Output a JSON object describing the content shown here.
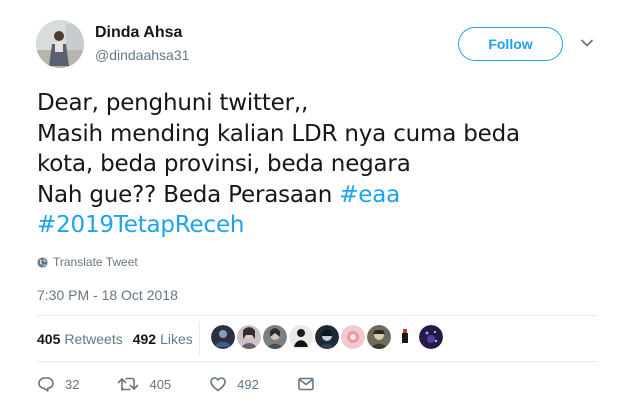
{
  "user": {
    "display_name": "Dinda Ahsa",
    "handle": "@dindaahsa31"
  },
  "follow_label": "Follow",
  "tweet": {
    "line1": "Dear, penghuni twitter,,",
    "line2": "Masih mending kalian LDR nya cuma beda",
    "line3": "kota, beda provinsi, beda negara",
    "line4_text": "Nah gue?? Beda Perasaan ",
    "hashtag1": "#eaa",
    "hashtag2": "#2019TetapReceh"
  },
  "translate_label": "Translate Tweet",
  "timestamp": "7:30 PM - 18 Oct 2018",
  "stats": {
    "retweets_count": "405",
    "retweets_label": "Retweets",
    "likes_count": "492",
    "likes_label": "Likes"
  },
  "actions": {
    "reply_count": "32",
    "retweet_count": "405",
    "like_count": "492"
  },
  "icons": [
    "chevron-down-icon",
    "globe-icon",
    "reply-icon",
    "retweet-icon",
    "heart-icon",
    "message-icon"
  ],
  "colors": {
    "accent": "#1da1f2",
    "secondary_text": "#657786",
    "primary_text": "#14171a",
    "divider": "#e6ecf0"
  }
}
